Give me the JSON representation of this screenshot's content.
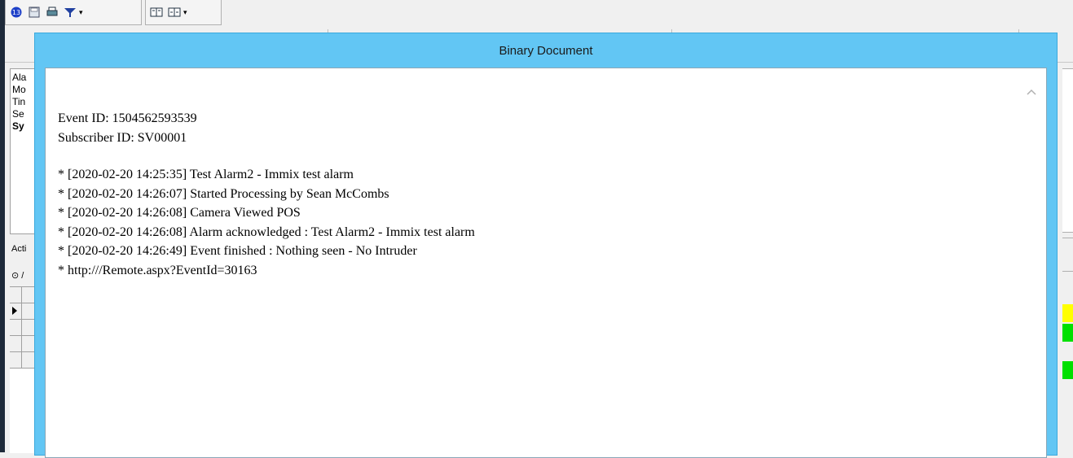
{
  "background_app": {
    "toolbar": {
      "icons": [
        "number-badge-icon",
        "link-icon",
        "save-icon",
        "print-icon",
        "filter-icon",
        "book-icon",
        "book-2-icon"
      ],
      "dropdown_glyph": "▾"
    },
    "info_panel_lines": [
      "Ala",
      "Mo",
      "Tin",
      "Se",
      "Sy"
    ],
    "actions_label": "Acti",
    "radio_label": "⊙ /",
    "status_colors": [
      "#ffff00",
      "#00e000",
      "#00e000"
    ]
  },
  "dialog": {
    "title": "Binary Document",
    "event_id": "Event ID: 1504562593539",
    "subscriber_id": "Subscriber ID: SV00001",
    "log_entries": [
      "* [2020-02-20 14:25:35] Test Alarm2 - Immix test alarm",
      "* [2020-02-20 14:26:07] Started Processing by Sean McCombs",
      "* [2020-02-20 14:26:08] Camera Viewed POS",
      "* [2020-02-20 14:26:08] Alarm acknowledged : Test Alarm2 - Immix test alarm",
      "* [2020-02-20 14:26:49] Event finished : Nothing seen - No Intruder",
      "* http:///Remote.aspx?EventId=30163"
    ],
    "colors": {
      "title_bar": "#62c6f4",
      "body": "#ffffff"
    }
  }
}
